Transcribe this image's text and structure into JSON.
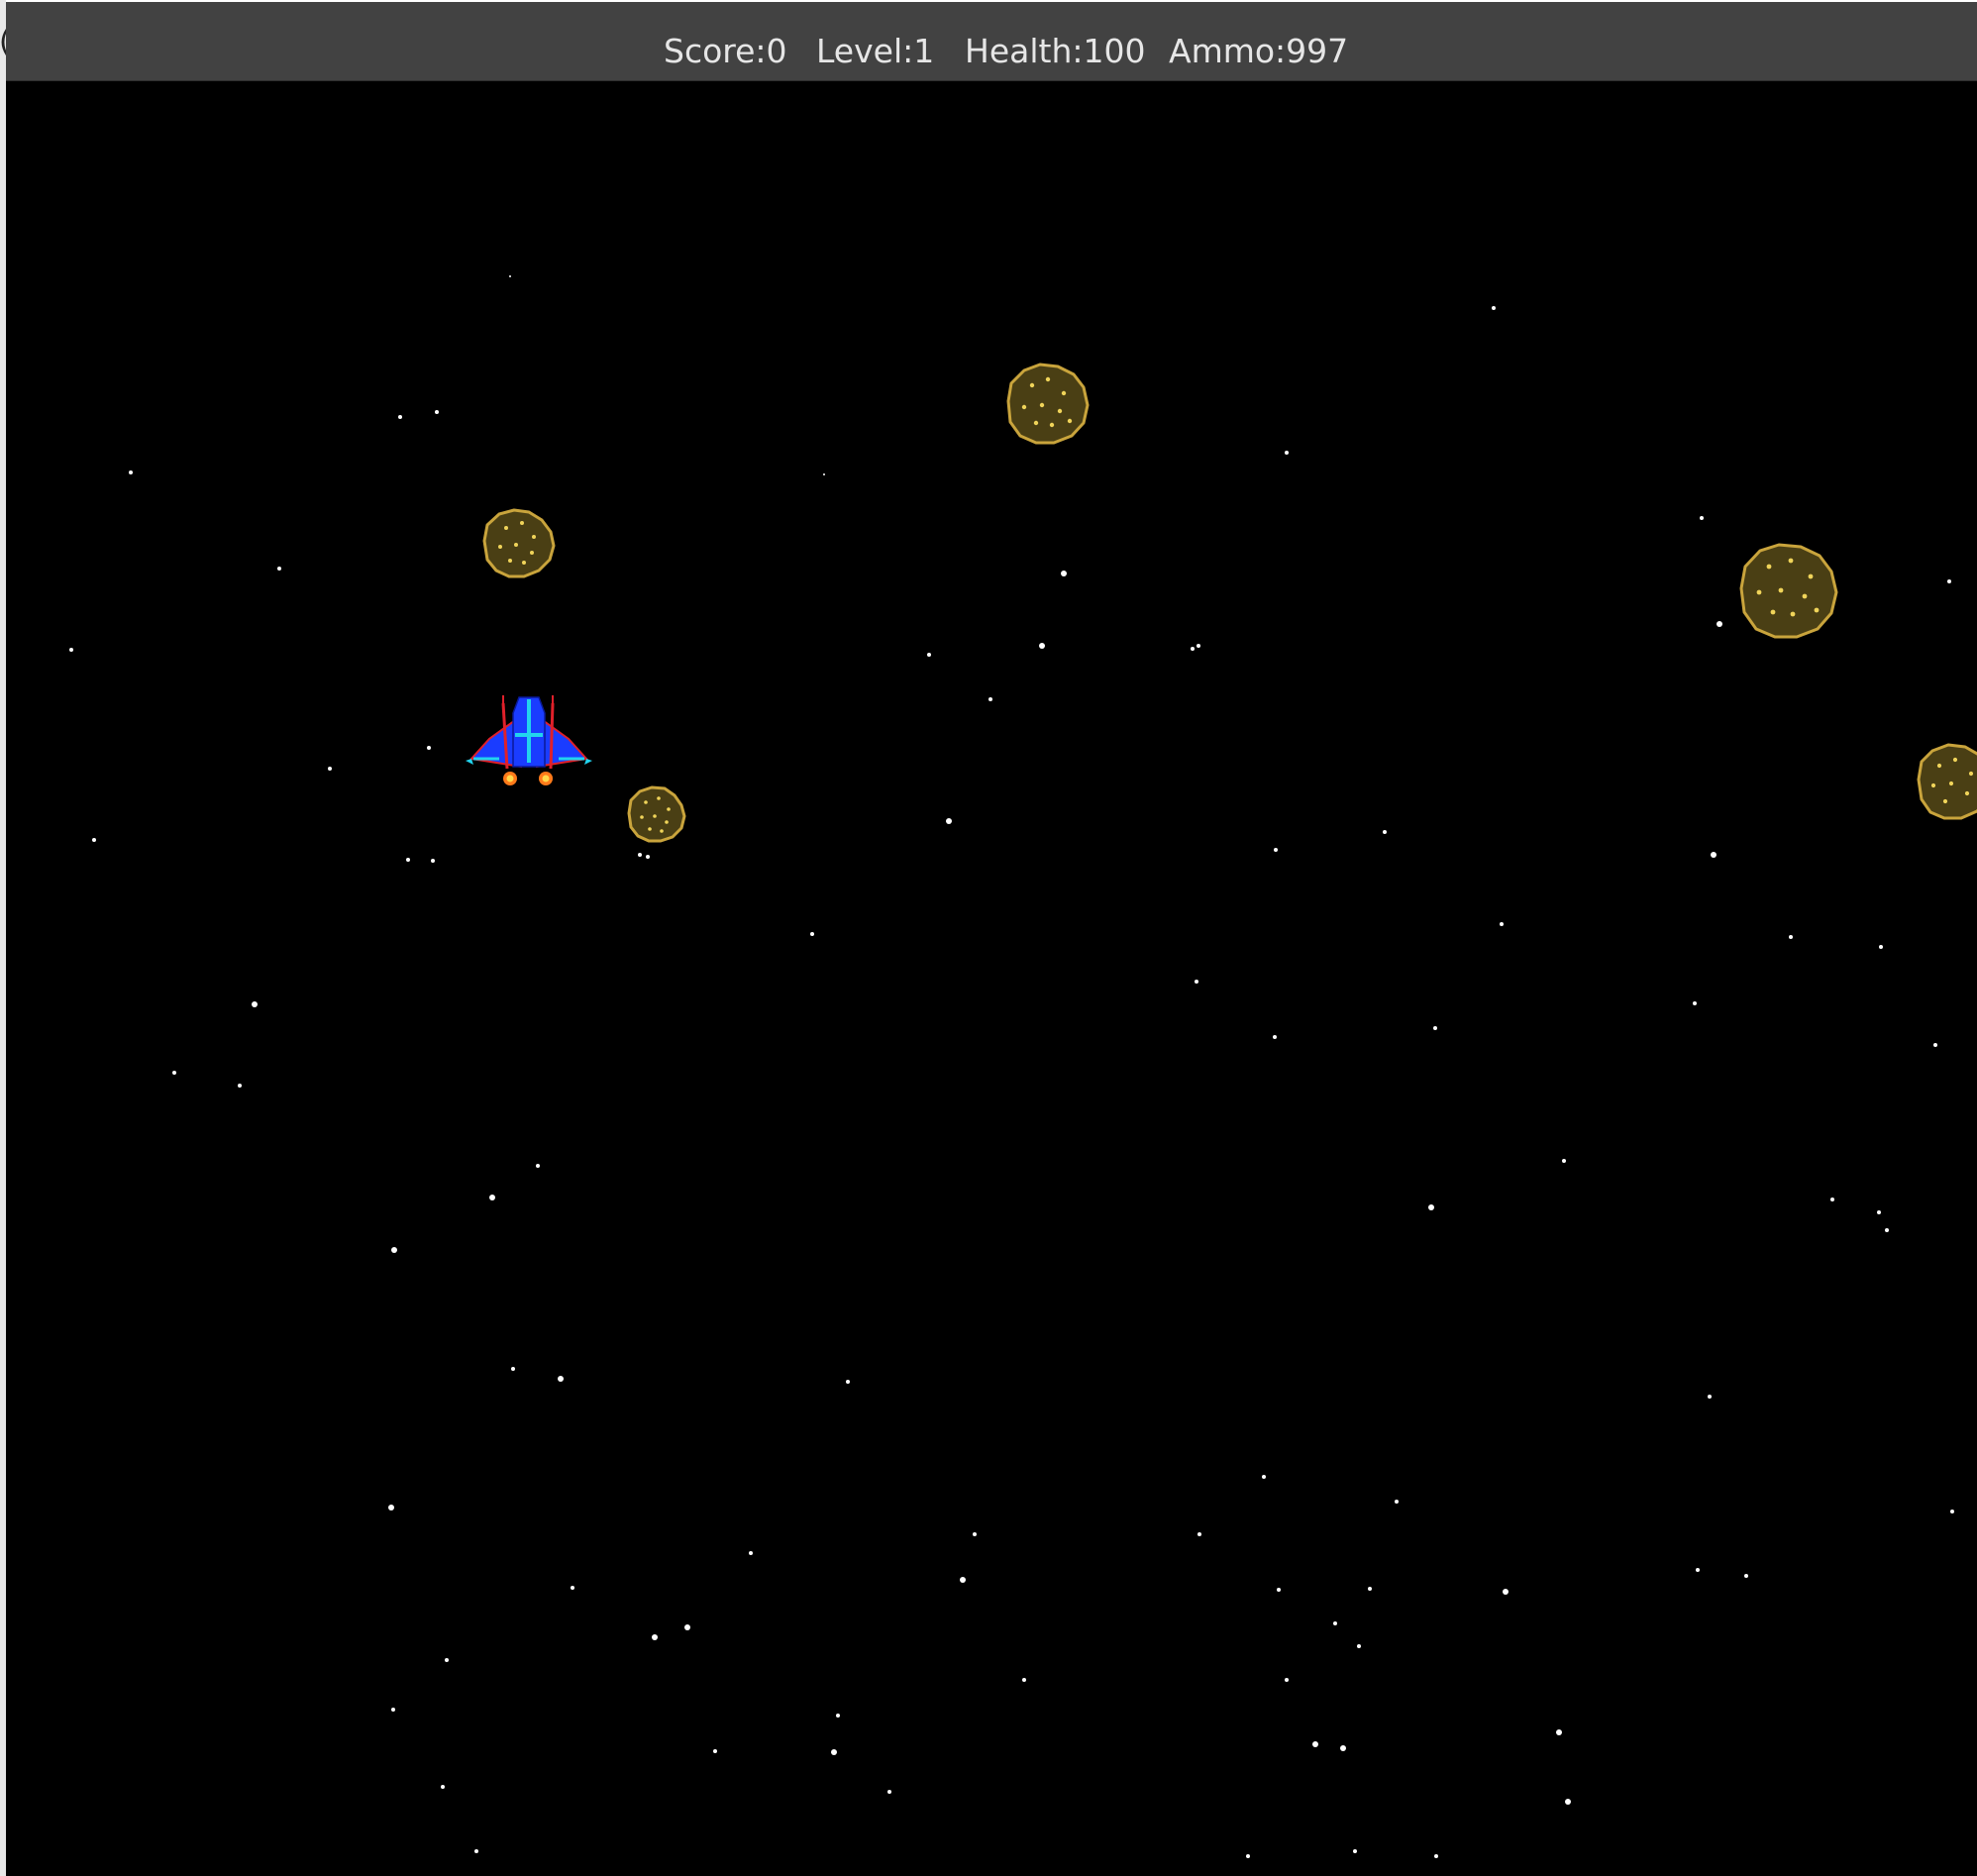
{
  "window": {
    "edge_text": "("
  },
  "hud": {
    "score": "Score:0",
    "level": "Level:1",
    "health": "Health:100",
    "ammo": "Ammo:997"
  },
  "colors": {
    "hud_bg": "#424242",
    "hud_text": "#e6e6e6",
    "space": "#000000",
    "star": "#ffffff",
    "asteroid_fill": "#4a3f14",
    "asteroid_outline": "#c9a43c",
    "asteroid_speck": "#f0d45a",
    "ship_body": "#1a3cff",
    "ship_trim": "#e0202a",
    "ship_cockpit": "#22d3ee",
    "ship_flame": "#ff7a1a"
  },
  "sprites": {
    "player": "spaceship-icon",
    "asteroid": "asteroid-icon",
    "star": "star-dot"
  }
}
